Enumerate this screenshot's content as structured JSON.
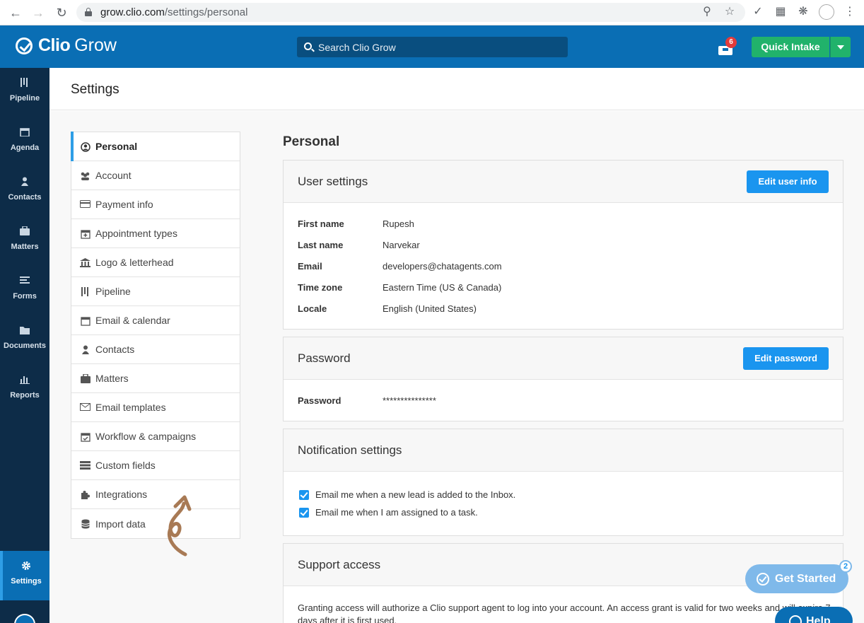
{
  "browser": {
    "url_host": "grow.clio.com",
    "url_path": "/settings/personal"
  },
  "header": {
    "logo_primary": "Clio",
    "logo_secondary": "Grow",
    "search_placeholder": "Search Clio Grow",
    "inbox_badge": "6",
    "quick_intake_label": "Quick Intake"
  },
  "sidebar": {
    "items": [
      {
        "label": "Pipeline",
        "icon": "pipeline-icon"
      },
      {
        "label": "Agenda",
        "icon": "calendar-icon"
      },
      {
        "label": "Contacts",
        "icon": "person-icon"
      },
      {
        "label": "Matters",
        "icon": "briefcase-icon"
      },
      {
        "label": "Forms",
        "icon": "list-icon"
      },
      {
        "label": "Documents",
        "icon": "folder-icon"
      },
      {
        "label": "Reports",
        "icon": "bar-chart-icon"
      }
    ],
    "active": {
      "label": "Settings",
      "icon": "gear-icon"
    }
  },
  "page": {
    "title": "Settings",
    "section_title": "Personal"
  },
  "settings_nav": [
    {
      "label": "Personal",
      "icon": "user-circle-icon",
      "active": true
    },
    {
      "label": "Account",
      "icon": "users-icon"
    },
    {
      "label": "Payment info",
      "icon": "credit-card-icon"
    },
    {
      "label": "Appointment types",
      "icon": "calendar-plus-icon"
    },
    {
      "label": "Logo & letterhead",
      "icon": "bank-icon"
    },
    {
      "label": "Pipeline",
      "icon": "pipeline-icon"
    },
    {
      "label": "Email & calendar",
      "icon": "calendar-icon"
    },
    {
      "label": "Contacts",
      "icon": "person-icon"
    },
    {
      "label": "Matters",
      "icon": "briefcase-icon"
    },
    {
      "label": "Email templates",
      "icon": "envelope-icon"
    },
    {
      "label": "Workflow & campaigns",
      "icon": "calendar-check-icon"
    },
    {
      "label": "Custom fields",
      "icon": "list-icon"
    },
    {
      "label": "Integrations",
      "icon": "puzzle-icon"
    },
    {
      "label": "Import data",
      "icon": "database-icon"
    }
  ],
  "user_settings": {
    "title": "User settings",
    "button": "Edit user info",
    "fields": [
      {
        "label": "First name",
        "value": "Rupesh"
      },
      {
        "label": "Last name",
        "value": "Narvekar"
      },
      {
        "label": "Email",
        "value": "developers@chatagents.com"
      },
      {
        "label": "Time zone",
        "value": "Eastern Time (US & Canada)"
      },
      {
        "label": "Locale",
        "value": "English (United States)"
      }
    ]
  },
  "password": {
    "title": "Password",
    "button": "Edit password",
    "label": "Password",
    "value": "***************"
  },
  "notifications": {
    "title": "Notification settings",
    "options": [
      {
        "label": "Email me when a new lead is added to the Inbox.",
        "checked": true
      },
      {
        "label": "Email me when I am assigned to a task.",
        "checked": true
      }
    ]
  },
  "support": {
    "title": "Support access",
    "text": "Granting access will authorize a Clio support agent to log into your account. An access grant is valid for two weeks and will expire 7 days after it is first used."
  },
  "floating": {
    "get_started": "Get Started",
    "get_started_badge": "2",
    "help": "Help"
  },
  "colors": {
    "header_blue": "#0a6eb4",
    "sidebar_navy": "#0d2c48",
    "primary_button": "#1a95ef",
    "quick_intake_green": "#21b26b",
    "badge_red": "#e23b3b"
  }
}
